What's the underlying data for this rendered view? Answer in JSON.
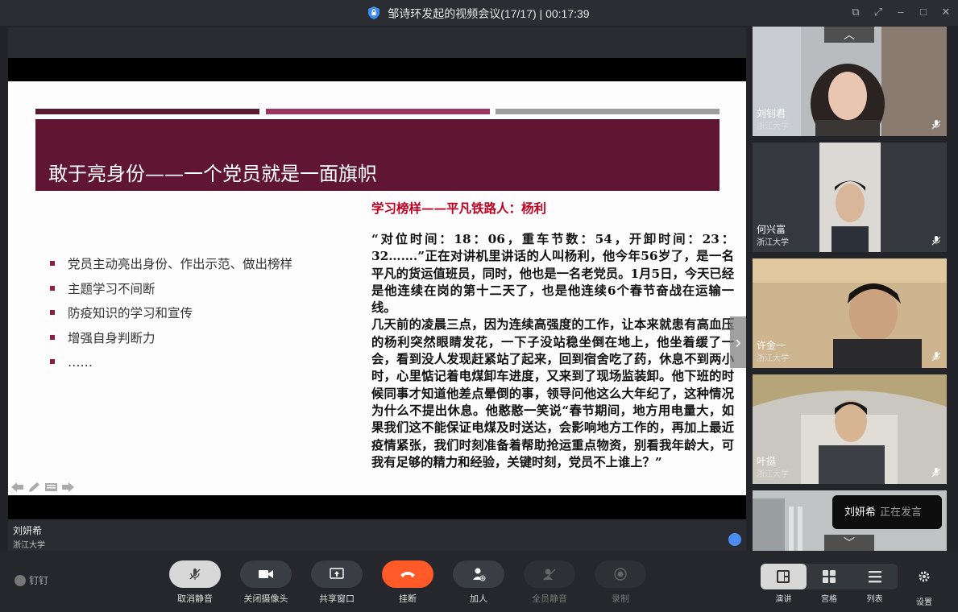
{
  "window": {
    "title": "邹诗环发起的视频会议(17/17) | 00:17:39"
  },
  "slide": {
    "title": "敢于亮身份——一个党员就是一面旗帜",
    "bullets": [
      "党员主动亮出身份、作出示范、做出榜样",
      "主题学习不间断",
      "防疫知识的学习和宣传",
      "增强自身判断力",
      "……"
    ],
    "story_title": "学习榜样——平凡铁路人：杨利",
    "story_p1": "“对位时间：18：06，重车节数：54，开卸时间：23：32…….”正在对讲机里讲话的人叫杨利，他今年56岁了，是一名平凡的货运值班员，同时，他也是一名老党员。1月5日，今天已经是他连续在岗的第十二天了，也是他连续6个春节奋战在运输一线。",
    "story_p2": "几天前的凌晨三点，因为连续高强度的工作，让本来就患有高血压的杨利突然眼睛发花，一下子没站稳坐倒在地上，他坐着缓了一会，看到没人发现赶紧站了起来，回到宿舍吃了药，休息不到两小时，心里惦记着电煤卸车进度，又来到了现场监装卸。他下班的时候同事才知道他差点晕倒的事，领导问他这么大年纪了，这种情况为什么不提出休息。他憨憨一笑说“春节期间，地方用电量大，如果我们这不能保证电煤及时送达，会影响地方工作的，再加上最近疫情紧张，我们时刻准备着帮助抢运重点物资，别看我年龄大，可我有足够的精力和经验，关键时刻，党员不上谁上？”"
  },
  "presenter": {
    "name": "刘妍希",
    "org": "浙江大学"
  },
  "participants": [
    {
      "name": "刘钊君",
      "org": "浙江大学"
    },
    {
      "name": "何兴富",
      "org": "浙江大学"
    },
    {
      "name": "许金一",
      "org": "浙江大学"
    },
    {
      "name": "叶挺",
      "org": "浙江大学"
    }
  ],
  "speaking_toast": {
    "name": "刘妍希",
    "status": "正在发言"
  },
  "toolbar": {
    "brand": "钉钉",
    "unmute": "取消静音",
    "camera_off": "关闭摄像头",
    "share_window": "共享窗口",
    "hangup": "挂断",
    "add": "加人",
    "mute_all": "全员静音",
    "record": "录制",
    "view_speaker": "演讲",
    "view_grid": "宫格",
    "view_list": "列表",
    "settings": "设置"
  },
  "colors": {
    "banner": "#601632",
    "hangup": "#ff5a27",
    "story_title": "#c0001f"
  }
}
